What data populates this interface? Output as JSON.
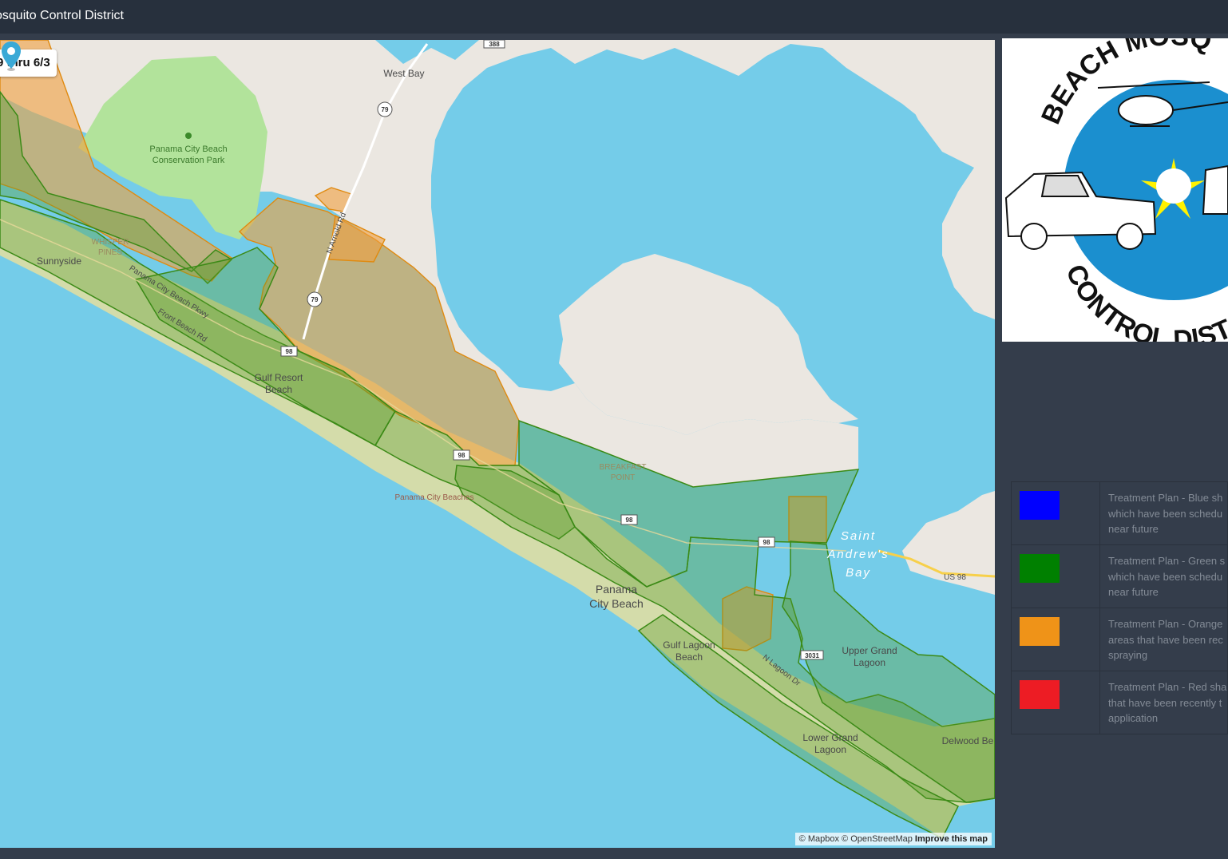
{
  "header": {
    "title": "osquito Control District"
  },
  "map": {
    "date_range": "9 thru 6/3",
    "attribution": {
      "mapbox": "© Mapbox",
      "osm": "© OpenStreetMap",
      "improve": "Improve this map"
    },
    "labels": {
      "west_bay": "West Bay",
      "conservation_1": "Panama City Beach",
      "conservation_2": "Conservation Park",
      "sunnyside": "Sunnyside",
      "whisper_1": "WHISPER",
      "whisper_2": "PINES",
      "pcb_pkwy": "Panama City Beach Pkwy",
      "front_beach": "Front Beach Rd",
      "gulf_resort_1": "Gulf Resort",
      "gulf_resort_2": "Beach",
      "n_arnold": "N Arnold Rd",
      "pcb_beaches": "Panama City Beaches",
      "breakfast_1": "BREAKFAST",
      "breakfast_2": "POINT",
      "pcb_city_1": "Panama",
      "pcb_city_2": "City Beach",
      "gulf_lagoon_1": "Gulf Lagoon",
      "gulf_lagoon_2": "Beach",
      "n_lagoon": "N Lagoon Dr",
      "upper_grand_1": "Upper Grand",
      "upper_grand_2": "Lagoon",
      "lower_grand_1": "Lower Grand",
      "lower_grand_2": "Lagoon",
      "st_andrews_1": "Saint",
      "st_andrews_2": "Andrew's",
      "st_andrews_3": "Bay",
      "us98": "US 98",
      "delwood": "Delwood Be"
    },
    "shields": {
      "r79": "79",
      "r98": "98",
      "r388": "388",
      "r3031": "3031"
    },
    "zone_colors": {
      "green": "#3f8f1c",
      "orange": "#f0a040"
    }
  },
  "logo": {
    "top_text": "BEACH MOSQ",
    "bottom_text": "CONTROL DIST"
  },
  "legend": {
    "items": [
      {
        "color": "#0000ff",
        "lines": [
          "Treatment Plan - Blue sh",
          "which have been schedu",
          "near future"
        ]
      },
      {
        "color": "#008000",
        "lines": [
          "Treatment Plan - Green s",
          "which have been schedu",
          "near future"
        ]
      },
      {
        "color": "#ef9318",
        "lines": [
          "Treatment Plan - Orange",
          "areas that have been rec",
          "spraying"
        ]
      },
      {
        "color": "#ed1c24",
        "lines": [
          "Treatment Plan - Red sha",
          "that have been recently t",
          "application"
        ]
      }
    ]
  }
}
